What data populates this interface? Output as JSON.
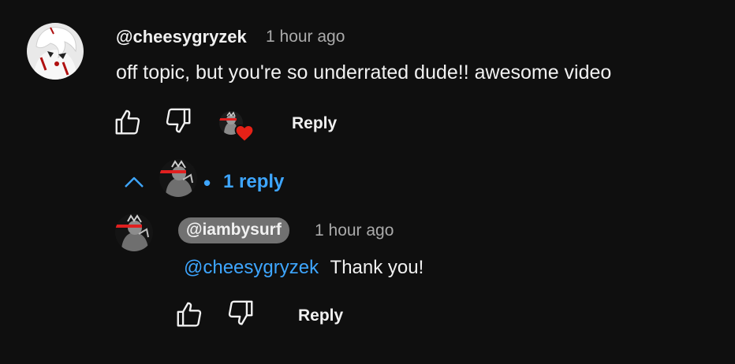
{
  "comment": {
    "author": "@cheesygryzek",
    "time": "1 hour ago",
    "text": "off topic, but you're so underrated dude!! awesome video",
    "like_icon": "thumb-up-icon",
    "dislike_icon": "thumb-down-icon",
    "heart_icon": "creator-heart-icon",
    "reply_label": "Reply"
  },
  "replies_toggle": {
    "icon": "chevron-up-icon",
    "bullet": "•",
    "label": "1 reply"
  },
  "reply": {
    "author": "@iambysurf",
    "time": "1 hour ago",
    "mention": "@cheesygryzek",
    "text": "Thank you!",
    "like_icon": "thumb-up-icon",
    "dislike_icon": "thumb-down-icon",
    "reply_label": "Reply"
  },
  "colors": {
    "background": "#0f0f0f",
    "text": "#f1f1f1",
    "secondary_text": "#aaaaaa",
    "link": "#3ea6ff",
    "author_chip": "#717171",
    "heart": "#e62117"
  }
}
